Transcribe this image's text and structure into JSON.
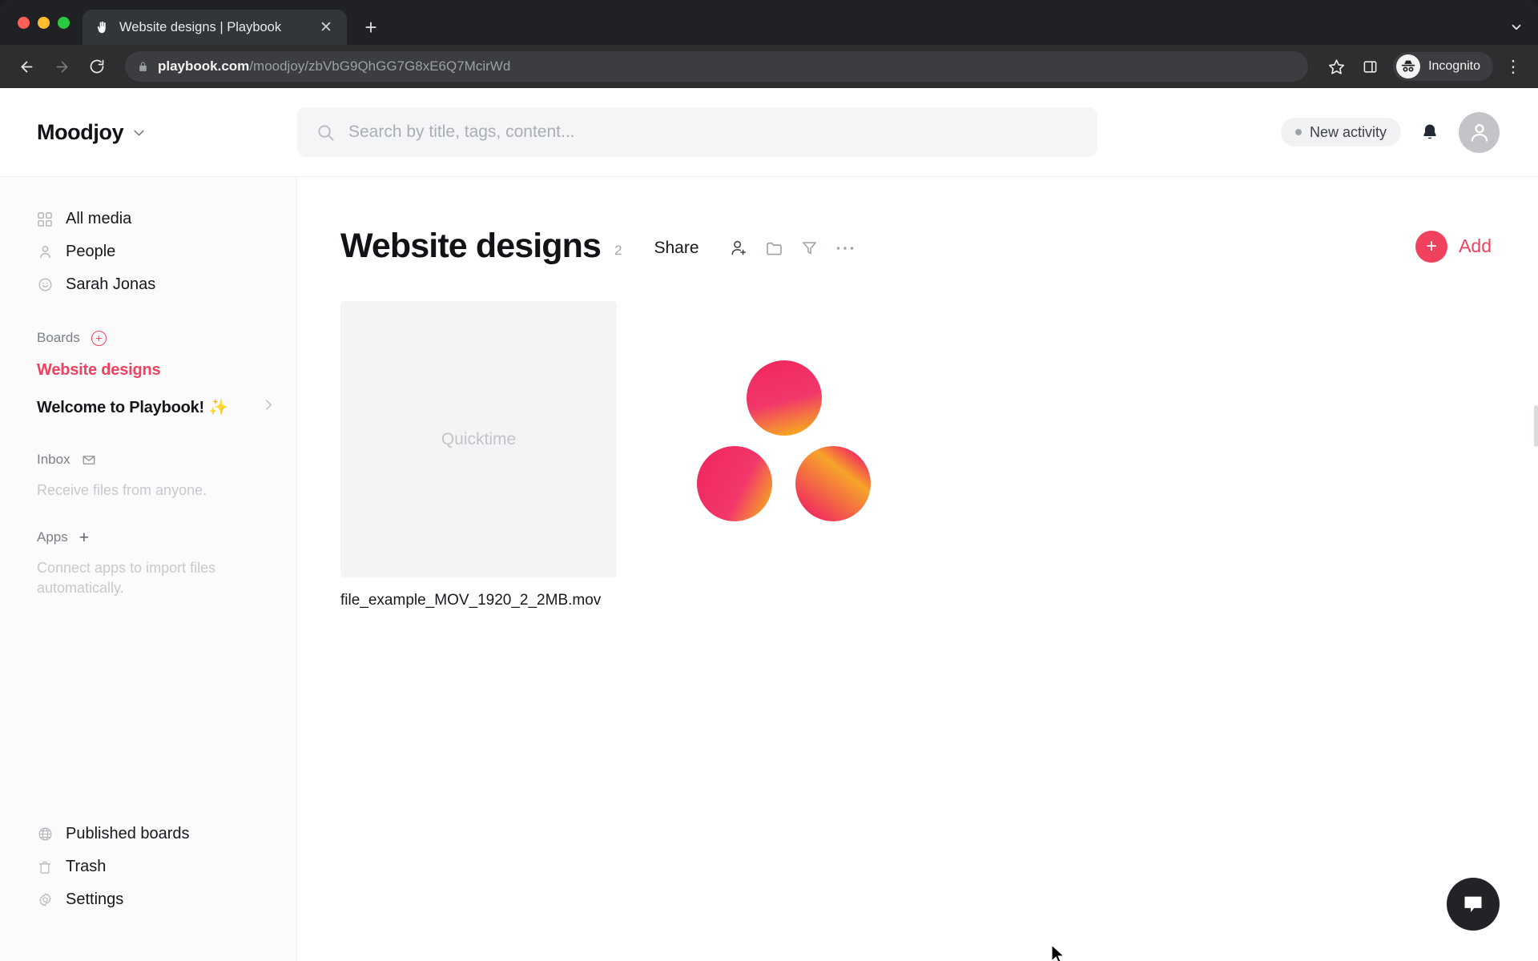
{
  "browser": {
    "tab": {
      "title": "Website designs | Playbook",
      "favicon_icon": "playbook-hand-favicon",
      "close_icon": "close-icon"
    },
    "new_tab_label": "+",
    "tabstrip_expand_icon": "chevron-down-icon",
    "nav": {
      "back_icon": "arrow-left-icon",
      "forward_icon": "arrow-right-icon",
      "reload_icon": "reload-icon",
      "lock_icon": "lock-icon",
      "url_host": "playbook.com",
      "url_path": "/moodjoy/zbVbG9QhGG7G8xE6Q7McirWd",
      "bookmark_icon": "star-icon",
      "side_panel_icon": "side-panel-icon",
      "incognito_label": "Incognito",
      "incognito_icon": "incognito-icon",
      "menu_icon": "kebab-menu-icon"
    }
  },
  "header": {
    "brand": "Moodjoy",
    "brand_caret_icon": "chevron-down-icon",
    "search": {
      "placeholder": "Search by title, tags, content...",
      "value": "",
      "icon": "search-icon"
    },
    "activity_label": "New activity",
    "notifications_icon": "bell-icon",
    "avatar_icon": "user-avatar-icon"
  },
  "sidebar": {
    "nav_items": [
      {
        "label": "All media",
        "icon": "grid-icon"
      },
      {
        "label": "People",
        "icon": "person-icon"
      },
      {
        "label": "Sarah Jonas",
        "icon": "smiley-icon"
      }
    ],
    "boards_section": {
      "title": "Boards",
      "add_icon": "plus-circle-icon",
      "items": [
        {
          "label": "Website designs",
          "active": true,
          "has_chevron": false
        },
        {
          "label": "Welcome to Playbook! ✨",
          "active": false,
          "has_chevron": true
        }
      ]
    },
    "inbox_section": {
      "title": "Inbox",
      "icon": "inbox-tray-icon",
      "hint": "Receive files from anyone."
    },
    "apps_section": {
      "title": "Apps",
      "icon": "plus-icon",
      "hint": "Connect apps to import files automatically."
    },
    "bottom_items": [
      {
        "label": "Published boards",
        "icon": "globe-icon"
      },
      {
        "label": "Trash",
        "icon": "trash-icon"
      },
      {
        "label": "Settings",
        "icon": "gear-icon"
      }
    ]
  },
  "main": {
    "board_title": "Website designs",
    "item_count": "2",
    "toolbar": {
      "share_label": "Share",
      "add_person_icon": "person-add-icon",
      "folder_icon": "folder-icon",
      "filter_icon": "filter-funnel-icon",
      "more_icon": "ellipsis-icon"
    },
    "add_button": {
      "label": "Add",
      "icon": "plus-icon"
    },
    "items": [
      {
        "type": "video",
        "placeholder_label": "Quicktime",
        "name": "file_example_MOV_1920_2_2MB.mov"
      },
      {
        "type": "image",
        "placeholder_label": "",
        "name": "",
        "graphic": "three-gradient-circles",
        "gradient_from": "#f0295f",
        "gradient_to": "#f5a623"
      }
    ],
    "chat_icon": "chat-bubble-icon"
  }
}
